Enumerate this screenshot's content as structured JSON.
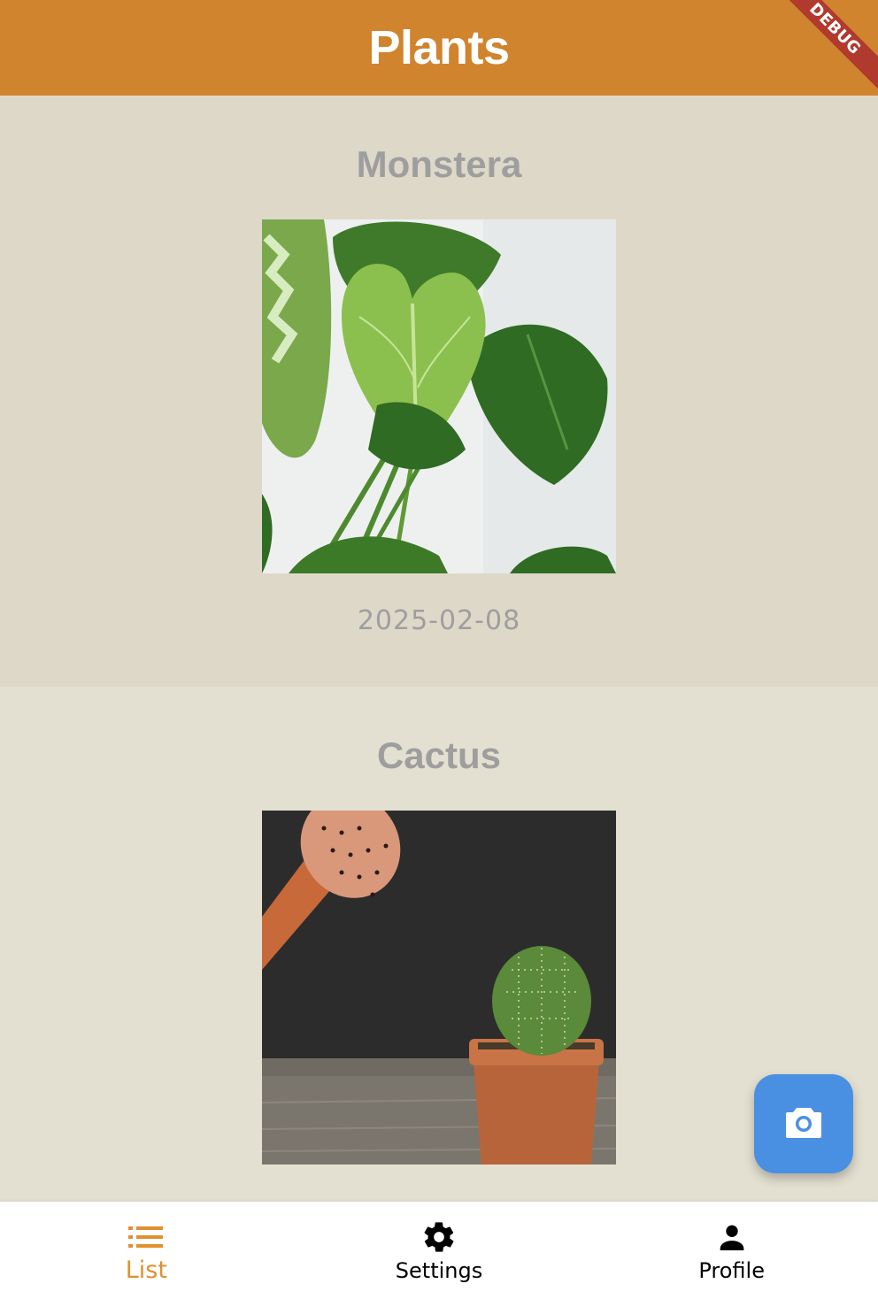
{
  "app_bar": {
    "title": "Plants",
    "debug_label": "DEBUG"
  },
  "plants": [
    {
      "name": "Monstera",
      "date": "2025-02-08"
    },
    {
      "name": "Cactus",
      "date": ""
    }
  ],
  "fab": {
    "icon": "camera-icon"
  },
  "bottom_nav": {
    "items": [
      {
        "label": "List",
        "icon": "list-icon",
        "active": true
      },
      {
        "label": "Settings",
        "icon": "gear-icon",
        "active": false
      },
      {
        "label": "Profile",
        "icon": "person-icon",
        "active": false
      }
    ]
  },
  "colors": {
    "app_bar": "#d0842e",
    "accent": "#e0902f",
    "fab": "#4a90e2",
    "card_alt": "#ded8c9",
    "background": "#e4e0d1"
  }
}
